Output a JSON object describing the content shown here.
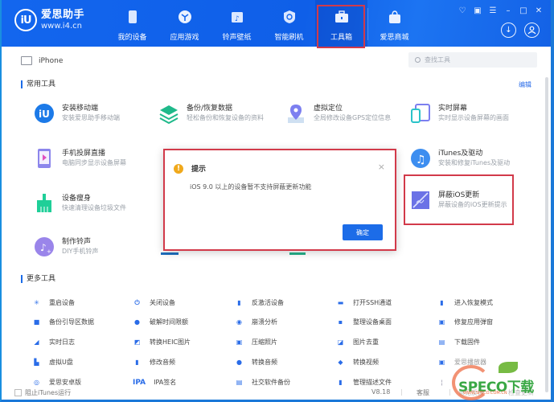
{
  "app": {
    "name": "爱思助手",
    "url": "www.i4.cn",
    "logo_badge": "iU"
  },
  "nav": [
    {
      "label": "我的设备",
      "icon": "phone-icon",
      "active": false
    },
    {
      "label": "应用游戏",
      "icon": "app-cube-icon",
      "active": false
    },
    {
      "label": "铃声壁纸",
      "icon": "music-folder-icon",
      "active": false
    },
    {
      "label": "智能刷机",
      "icon": "shield-refresh-icon",
      "active": false
    },
    {
      "label": "工具箱",
      "icon": "toolbox-icon",
      "active": true
    },
    {
      "label": "爱思商城",
      "icon": "shopping-bag-icon",
      "active": false
    }
  ],
  "window_controls": [
    "skin-icon",
    "note-icon",
    "menu-icon",
    "minimize-icon",
    "maximize-icon",
    "close-icon"
  ],
  "round_buttons": [
    "download-icon",
    "user-icon"
  ],
  "device": {
    "name": "iPhone"
  },
  "search": {
    "placeholder": "查找工具"
  },
  "sections": {
    "common_title": "常用工具",
    "edit_label": "编辑",
    "more_title": "更多工具"
  },
  "common_tools": [
    {
      "name": "安装移动端",
      "desc": "安装爱思助手移动端",
      "icon": "i4-logo-icon"
    },
    {
      "name": "备份/恢复数据",
      "desc": "轻松备份和恢复设备的资料",
      "icon": "layers-icon"
    },
    {
      "name": "虚拟定位",
      "desc": "全局修改设备GPS定位信息",
      "icon": "location-pin-icon"
    },
    {
      "name": "实时屏幕",
      "desc": "实时显示设备屏幕的画面",
      "icon": "screens-icon"
    },
    {
      "name": "手机投屏直播",
      "desc": "电脑同步显示设备屏幕",
      "icon": "screen-cast-icon"
    },
    {
      "name": "iTunes及驱动",
      "desc": "安装和修复iTunes及驱动",
      "icon": "music-note-icon"
    },
    {
      "name": "设备瘦身",
      "desc": "快速清理设备垃圾文件",
      "icon": "broom-icon"
    },
    {
      "name": "屏蔽iOS更新",
      "desc": "屏蔽设备的iOS更新提示",
      "icon": "block-update-icon"
    },
    {
      "name": "制作铃声",
      "desc": "DIY手机铃声",
      "icon": "ringtone-icon"
    }
  ],
  "more_tools": [
    {
      "label": "重启设备",
      "icon": "restart-icon"
    },
    {
      "label": "关闭设备",
      "icon": "power-icon"
    },
    {
      "label": "反激活设备",
      "icon": "deactivate-icon"
    },
    {
      "label": "打开SSH通道",
      "icon": "ssh-icon"
    },
    {
      "label": "进入恢复模式",
      "icon": "recovery-mode-icon"
    },
    {
      "label": "备份引导区数据",
      "icon": "boot-backup-icon"
    },
    {
      "label": "破解时间限额",
      "icon": "clock-icon"
    },
    {
      "label": "崩溃分析",
      "icon": "crash-analysis-icon"
    },
    {
      "label": "整理设备桌面",
      "icon": "desktop-grid-icon"
    },
    {
      "label": "修复应用弹窗",
      "icon": "app-repair-icon"
    },
    {
      "label": "实时日志",
      "icon": "log-icon"
    },
    {
      "label": "转换HEIC图片",
      "icon": "heic-convert-icon"
    },
    {
      "label": "压缩照片",
      "icon": "compress-photo-icon"
    },
    {
      "label": "图片去重",
      "icon": "photo-dedupe-icon"
    },
    {
      "label": "下载固件",
      "icon": "firmware-download-icon"
    },
    {
      "label": "虚拟U盘",
      "icon": "usb-drive-icon"
    },
    {
      "label": "修改音频",
      "icon": "audio-edit-icon"
    },
    {
      "label": "转换音频",
      "icon": "audio-convert-icon"
    },
    {
      "label": "转换视频",
      "icon": "video-convert-icon"
    },
    {
      "label": "爱思播放器",
      "icon": "player-icon"
    },
    {
      "label": "爱思安卓版",
      "icon": "android-version-icon"
    },
    {
      "label": "IPA签名",
      "icon": "ipa-icon",
      "glyph": "IPA"
    },
    {
      "label": "社交软件备份",
      "icon": "social-backup-icon"
    },
    {
      "label": "管理描述文件",
      "icon": "profile-icon"
    },
    {
      "label": "",
      "icon": "misc-tool-icon"
    }
  ],
  "dialog": {
    "title": "提示",
    "message": "iOS 9.0 以上的设备暂不支持屏蔽更新功能",
    "ok_label": "确定",
    "close_glyph": "×",
    "warn_glyph": "!"
  },
  "footer": {
    "block_itunes_label": "阻止iTunes运行",
    "version": "V8.18",
    "support_label": "客服",
    "feedback_label": "意见反馈",
    "update_label": "检查更新"
  },
  "watermark": {
    "text": "SPECO下载",
    "url": "WWW.SPECO.COM.CN"
  },
  "colors": {
    "brand_blue": "#1366ee",
    "accent_blue": "#1c6ce8",
    "highlight_red": "#d23a4a",
    "warn_orange": "#f0a91c"
  }
}
